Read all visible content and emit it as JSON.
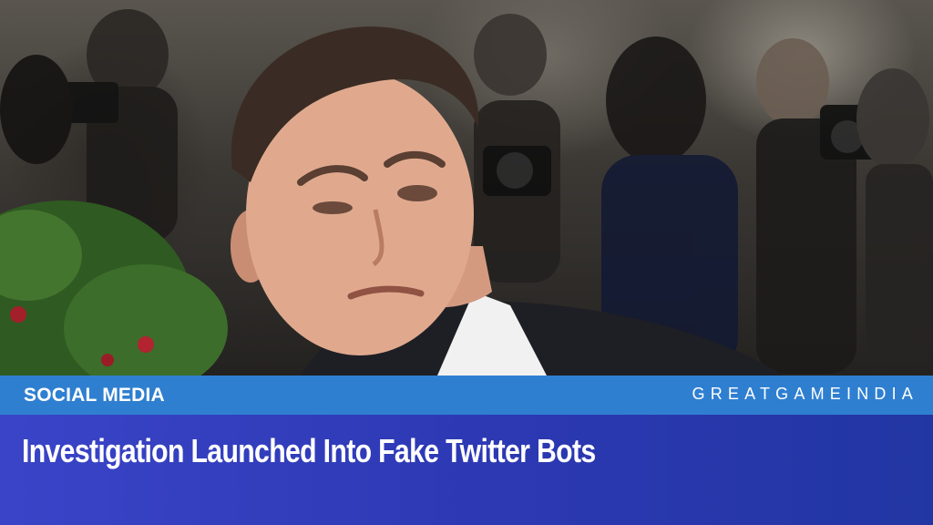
{
  "category": {
    "label": "SOCIAL MEDIA"
  },
  "brand": {
    "name": "GREATGAMEINDIA"
  },
  "headline": {
    "text": "Investigation Launched Into Fake Twitter Bots"
  },
  "photo": {
    "subject": "man with raised eyebrow and pursed lips in front of photographers"
  },
  "colors": {
    "category_bar": "#2f7fd1",
    "headline_band_start": "#3a44c8",
    "headline_band_end": "#2236a3",
    "text": "#ffffff"
  }
}
